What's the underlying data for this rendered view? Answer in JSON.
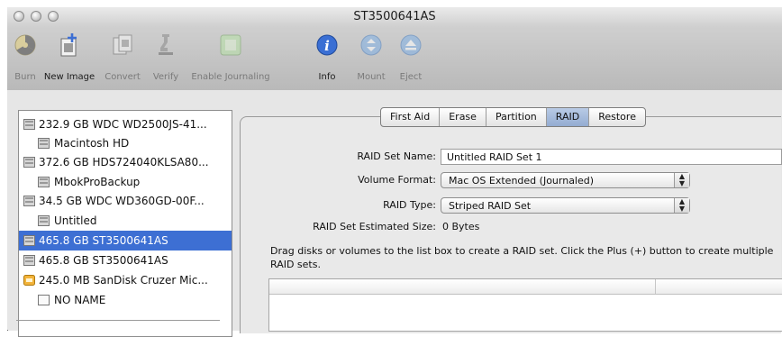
{
  "window": {
    "title": "ST3500641AS"
  },
  "toolbar": {
    "items": [
      {
        "label": "Burn",
        "enabled": false,
        "icon": "burn-icon"
      },
      {
        "label": "New Image",
        "enabled": true,
        "icon": "new-image-icon"
      },
      {
        "label": "Convert",
        "enabled": false,
        "icon": "convert-icon"
      },
      {
        "label": "Verify",
        "enabled": false,
        "icon": "verify-icon"
      },
      {
        "label": "Enable Journaling",
        "enabled": false,
        "icon": "journaling-icon"
      },
      {
        "label": "Info",
        "enabled": true,
        "icon": "info-icon"
      },
      {
        "label": "Mount",
        "enabled": false,
        "icon": "mount-icon"
      },
      {
        "label": "Eject",
        "enabled": false,
        "icon": "eject-icon"
      }
    ]
  },
  "sidebar": {
    "items": [
      {
        "label": "232.9 GB WDC WD2500JS-41...",
        "kind": "disk",
        "selected": false
      },
      {
        "label": "Macintosh HD",
        "kind": "volume",
        "selected": false
      },
      {
        "label": "372.6 GB HDS724040KLSA80...",
        "kind": "disk",
        "selected": false
      },
      {
        "label": "MbokProBackup",
        "kind": "volume",
        "selected": false
      },
      {
        "label": "34.5 GB WDC WD360GD-00F...",
        "kind": "disk",
        "selected": false
      },
      {
        "label": "Untitled",
        "kind": "volume",
        "selected": false
      },
      {
        "label": "465.8 GB ST3500641AS",
        "kind": "disk",
        "selected": true
      },
      {
        "label": "465.8 GB ST3500641AS",
        "kind": "disk",
        "selected": false
      },
      {
        "label": "245.0 MB SanDisk Cruzer Mic...",
        "kind": "usb",
        "selected": false
      },
      {
        "label": "NO NAME",
        "kind": "volume-empty",
        "selected": false
      }
    ]
  },
  "tabs": {
    "items": [
      "First Aid",
      "Erase",
      "Partition",
      "RAID",
      "Restore"
    ],
    "active": "RAID"
  },
  "raid": {
    "set_name_label": "RAID Set Name:",
    "set_name_value": "Untitled RAID Set 1",
    "volume_format_label": "Volume Format:",
    "volume_format_value": "Mac OS Extended (Journaled)",
    "raid_type_label": "RAID Type:",
    "raid_type_value": "Striped RAID Set",
    "size_label": "RAID Set Estimated Size:",
    "size_value": "0 Bytes",
    "help_text": "Drag disks or volumes to the list box to create a RAID set. Click the Plus (+) button to create multiple RAID sets."
  },
  "colors": {
    "selection": "#3d6fd3",
    "active_tab": "#a7bde0"
  }
}
